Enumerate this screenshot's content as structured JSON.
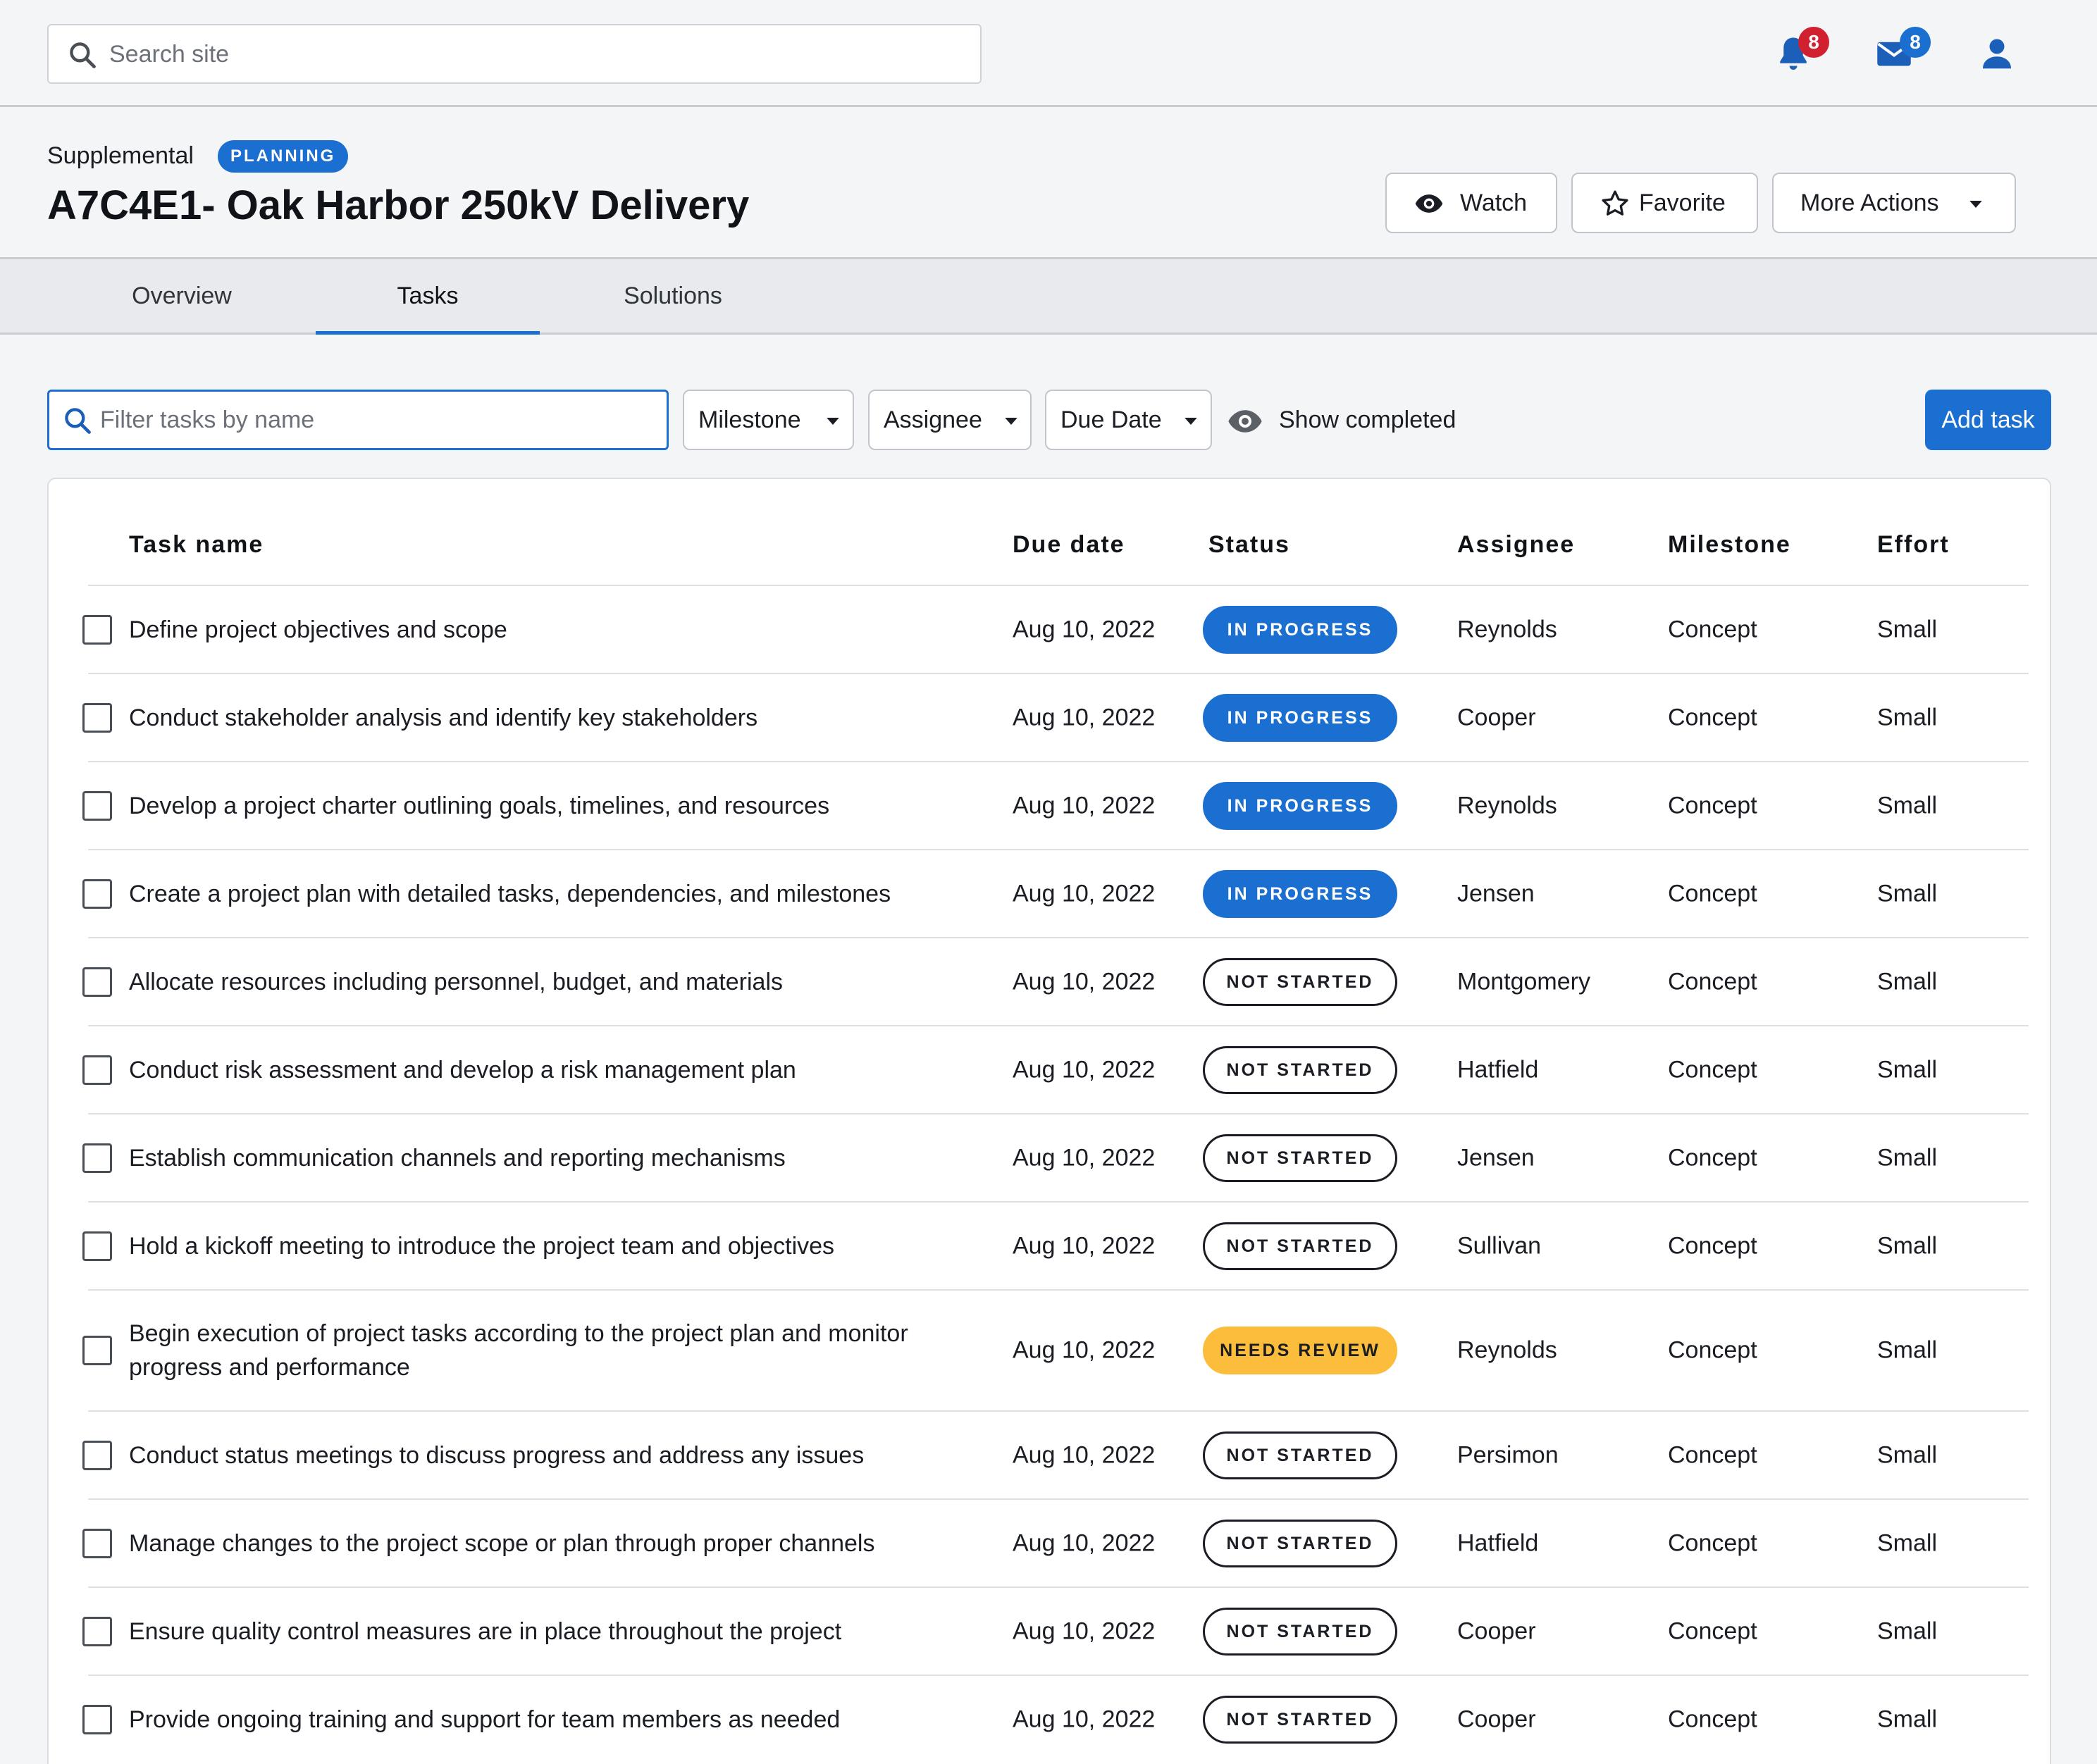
{
  "topbar": {
    "search_placeholder": "Search site",
    "notifications_count": "8",
    "messages_count": "8",
    "notification_badge_color": "#d1202f",
    "message_badge_color": "#1b6fd0"
  },
  "header": {
    "category": "Supplemental",
    "phase_badge": "PLANNING",
    "title": "A7C4E1- Oak Harbor 250kV Delivery",
    "watch_label": "Watch",
    "favorite_label": "Favorite",
    "more_actions_label": "More Actions"
  },
  "tabs": [
    {
      "label": "Overview",
      "active": false
    },
    {
      "label": "Tasks",
      "active": true
    },
    {
      "label": "Solutions",
      "active": false
    }
  ],
  "toolbar": {
    "filter_placeholder": "Filter tasks by name",
    "milestone_label": "Milestone",
    "assignee_label": "Assignee",
    "due_date_label": "Due Date",
    "show_completed_label": "Show completed",
    "add_task_label": "Add task"
  },
  "table": {
    "columns": {
      "task_name": "Task name",
      "due_date": "Due date",
      "status": "Status",
      "assignee": "Assignee",
      "milestone": "Milestone",
      "effort": "Effort"
    },
    "rows": [
      {
        "task": "Define project objectives and scope",
        "due": "Aug 10, 2022",
        "status": "IN PROGRESS",
        "status_kind": "inprogress",
        "assignee": "Reynolds",
        "milestone": "Concept",
        "effort": "Small"
      },
      {
        "task": "Conduct stakeholder analysis and identify key stakeholders",
        "due": "Aug 10, 2022",
        "status": "IN PROGRESS",
        "status_kind": "inprogress",
        "assignee": "Cooper",
        "milestone": "Concept",
        "effort": "Small"
      },
      {
        "task": "Develop a project charter outlining goals, timelines, and resources",
        "due": "Aug 10, 2022",
        "status": "IN PROGRESS",
        "status_kind": "inprogress",
        "assignee": "Reynolds",
        "milestone": "Concept",
        "effort": "Small"
      },
      {
        "task": "Create a project plan with detailed tasks, dependencies, and milestones",
        "due": "Aug 10, 2022",
        "status": "IN PROGRESS",
        "status_kind": "inprogress",
        "assignee": "Jensen",
        "milestone": "Concept",
        "effort": "Small"
      },
      {
        "task": "Allocate resources including personnel, budget, and materials",
        "due": "Aug 10, 2022",
        "status": "NOT STARTED",
        "status_kind": "notstarted",
        "assignee": "Montgomery",
        "milestone": "Concept",
        "effort": "Small"
      },
      {
        "task": "Conduct risk assessment and develop a risk management plan",
        "due": "Aug 10, 2022",
        "status": "NOT STARTED",
        "status_kind": "notstarted",
        "assignee": "Hatfield",
        "milestone": "Concept",
        "effort": "Small"
      },
      {
        "task": "Establish communication channels and reporting mechanisms",
        "due": "Aug 10, 2022",
        "status": "NOT STARTED",
        "status_kind": "notstarted",
        "assignee": "Jensen",
        "milestone": "Concept",
        "effort": "Small"
      },
      {
        "task": "Hold a kickoff meeting to introduce the project team and objectives",
        "due": "Aug 10, 2022",
        "status": "NOT STARTED",
        "status_kind": "notstarted",
        "assignee": "Sullivan",
        "milestone": "Concept",
        "effort": "Small"
      },
      {
        "task": "Begin execution of project tasks according to the project plan and monitor progress and performance",
        "due": "Aug 10, 2022",
        "status": "NEEDS REVIEW",
        "status_kind": "needsreview",
        "assignee": "Reynolds",
        "milestone": "Concept",
        "effort": "Small"
      },
      {
        "task": "Conduct status meetings to discuss progress and address any issues",
        "due": "Aug 10, 2022",
        "status": "NOT STARTED",
        "status_kind": "notstarted",
        "assignee": "Persimon",
        "milestone": "Concept",
        "effort": "Small"
      },
      {
        "task": "Manage changes to the project scope or plan through proper channels",
        "due": "Aug 10, 2022",
        "status": "NOT STARTED",
        "status_kind": "notstarted",
        "assignee": "Hatfield",
        "milestone": "Concept",
        "effort": "Small"
      },
      {
        "task": "Ensure quality control measures are in place throughout the project",
        "due": "Aug 10, 2022",
        "status": "NOT STARTED",
        "status_kind": "notstarted",
        "assignee": "Cooper",
        "milestone": "Concept",
        "effort": "Small"
      },
      {
        "task": "Provide ongoing training and support for team members as needed",
        "due": "Aug 10, 2022",
        "status": "NOT STARTED",
        "status_kind": "notstarted",
        "assignee": "Cooper",
        "milestone": "Concept",
        "effort": "Small"
      }
    ]
  },
  "icons": {
    "search": "search-icon",
    "notifications": "bell-icon",
    "messages": "envelope-icon",
    "profile": "user-icon",
    "watch": "eye-icon",
    "favorite": "star-icon",
    "dropdown": "caret-down-icon",
    "checkbox": "checkbox-icon"
  },
  "colors": {
    "primary": "#1b6fd0",
    "needs_review": "#fbbd3b",
    "notification_badge": "#d1202f"
  }
}
